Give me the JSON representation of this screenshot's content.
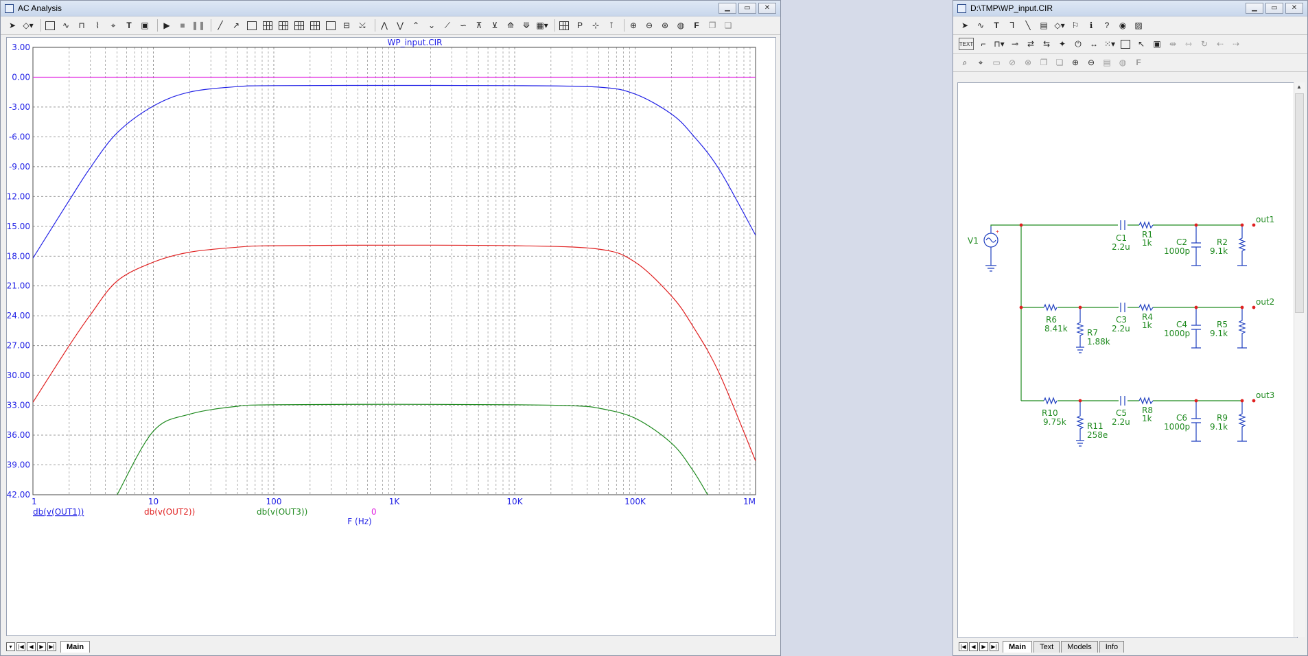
{
  "left_window": {
    "title": "AC Analysis",
    "tabs": [
      {
        "label": "Main"
      }
    ]
  },
  "right_window": {
    "title": "D:\\TMP\\WP_input.CIR",
    "tabs": [
      {
        "label": "Main"
      },
      {
        "label": "Text"
      },
      {
        "label": "Models"
      },
      {
        "label": "Info"
      }
    ],
    "toolbar_badge": "TEXT"
  },
  "chart_data": {
    "type": "line",
    "title": "WP_input.CIR",
    "xlabel": "F (Hz)",
    "xscale": "log",
    "xlim": [
      1,
      1000000
    ],
    "ylim": [
      -42,
      3
    ],
    "grid": true,
    "x_ticks": [
      "1",
      "10",
      "100",
      "1K",
      "10K",
      "100K",
      "1M"
    ],
    "y_ticks": [
      "3.00",
      "0.00",
      "-3.00",
      "-6.00",
      "-9.00",
      "-12.00",
      "-15.00",
      "-18.00",
      "-21.00",
      "-24.00",
      "-27.00",
      "-30.00",
      "-33.00",
      "-36.00",
      "-39.00",
      "-42.00"
    ],
    "legend_extra": "0",
    "colors": {
      "out1": "#2323e6",
      "out2": "#e02020",
      "out3": "#1f8a1f",
      "zero": "#e020e0"
    },
    "series": [
      {
        "name": "db(v(OUT1))",
        "x": [
          1,
          2,
          3,
          5,
          10,
          20,
          50,
          100,
          1000,
          10000,
          50000,
          100000,
          200000,
          300000,
          500000,
          1000000
        ],
        "y": [
          -18.2,
          -12.4,
          -9.1,
          -5.6,
          -2.9,
          -1.5,
          -0.95,
          -0.85,
          -0.83,
          -0.85,
          -1.0,
          -1.7,
          -3.7,
          -5.8,
          -9.3,
          -15.9
        ]
      },
      {
        "name": "db(v(OUT2))",
        "x": [
          1,
          2,
          3,
          5,
          10,
          20,
          50,
          100,
          1000,
          10000,
          50000,
          100000,
          200000,
          300000,
          500000,
          1000000
        ],
        "y": [
          -32.7,
          -27.0,
          -23.9,
          -20.5,
          -18.6,
          -17.6,
          -17.1,
          -16.95,
          -16.9,
          -16.95,
          -17.3,
          -18.6,
          -22.0,
          -25.0,
          -29.8,
          -38.6
        ]
      },
      {
        "name": "db(v(OUT3))",
        "x": [
          5,
          10,
          20,
          50,
          100,
          1000,
          10000,
          30000,
          50000,
          100000,
          200000,
          300000,
          400000
        ],
        "y": [
          -42.0,
          -35.6,
          -33.9,
          -33.1,
          -32.95,
          -32.9,
          -32.95,
          -33.05,
          -33.3,
          -34.3,
          -36.8,
          -39.5,
          -42.0
        ]
      },
      {
        "name": "",
        "x": [
          1,
          1000000
        ],
        "y": [
          0,
          0
        ]
      }
    ]
  },
  "schematic": {
    "source_label": "V1",
    "components": [
      {
        "id": "C1",
        "value": "2.2u"
      },
      {
        "id": "R1",
        "value": "1k"
      },
      {
        "id": "C2",
        "value": "1000p"
      },
      {
        "id": "R2",
        "value": "9.1k"
      },
      {
        "id": "R6",
        "value": "8.41k"
      },
      {
        "id": "R7",
        "value": "1.88k"
      },
      {
        "id": "C3",
        "value": "2.2u"
      },
      {
        "id": "R4",
        "value": "1k"
      },
      {
        "id": "C4",
        "value": "1000p"
      },
      {
        "id": "R5",
        "value": "9.1k"
      },
      {
        "id": "R10",
        "value": "9.75k"
      },
      {
        "id": "R11",
        "value": "258e"
      },
      {
        "id": "C5",
        "value": "2.2u"
      },
      {
        "id": "R8",
        "value": "1k"
      },
      {
        "id": "C6",
        "value": "1000p"
      },
      {
        "id": "R9",
        "value": "9.1k"
      }
    ],
    "nodes": [
      "out1",
      "out2",
      "out3"
    ]
  }
}
